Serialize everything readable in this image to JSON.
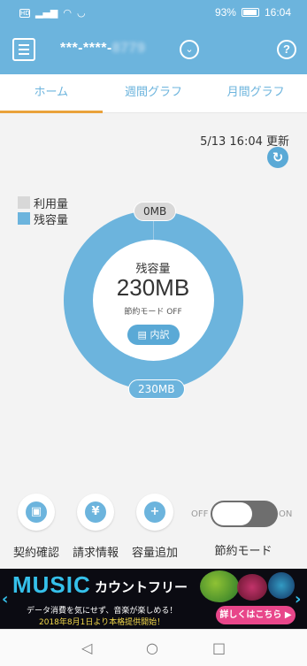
{
  "status_bar": {
    "battery": "93%",
    "time": "16:04",
    "sim_label": "HD"
  },
  "header": {
    "account_visible": "***-****-",
    "account_obscured": "8779",
    "menu_icon": "hamburger-menu-icon",
    "dropdown_icon": "chevron-down-icon",
    "help_icon": "help-icon",
    "help_glyph": "?"
  },
  "tabs": [
    {
      "label": "ホーム",
      "active": true
    },
    {
      "label": "週間グラフ",
      "active": false
    },
    {
      "label": "月間グラフ",
      "active": false
    }
  ],
  "main": {
    "updated": "5/13 16:04 更新",
    "legend": [
      {
        "label": "利用量",
        "color": "#d8d8d8"
      },
      {
        "label": "残容量",
        "color": "#6cb4dd"
      }
    ],
    "used_pill": "0MB",
    "remaining_pill": "230MB",
    "center_label": "残容量",
    "center_value": "230MB",
    "saving_mode_status": "節約モード OFF",
    "detail_button": "内訳",
    "usage_fraction": 0
  },
  "actions": [
    {
      "label": "契約確認",
      "icon": "clipboard-icon"
    },
    {
      "label": "請求情報",
      "icon": "yen-icon"
    },
    {
      "label": "容量追加",
      "icon": "database-add-icon"
    }
  ],
  "toggle": {
    "off_label": "OFF",
    "on_label": "ON",
    "label": "節約モード",
    "state": "off"
  },
  "banner": {
    "title": "MUSIC",
    "subtitle": "カウントフリー",
    "line1": "データ消費を気にせず、音楽が楽しめる！",
    "line2": "2018年8月1日より本格提供開始！",
    "cta": "詳しくはこちら ▶"
  },
  "colors": {
    "accent": "#6cb4dd",
    "tab_indicator": "#e9a23b",
    "cta": "#e8468a"
  }
}
